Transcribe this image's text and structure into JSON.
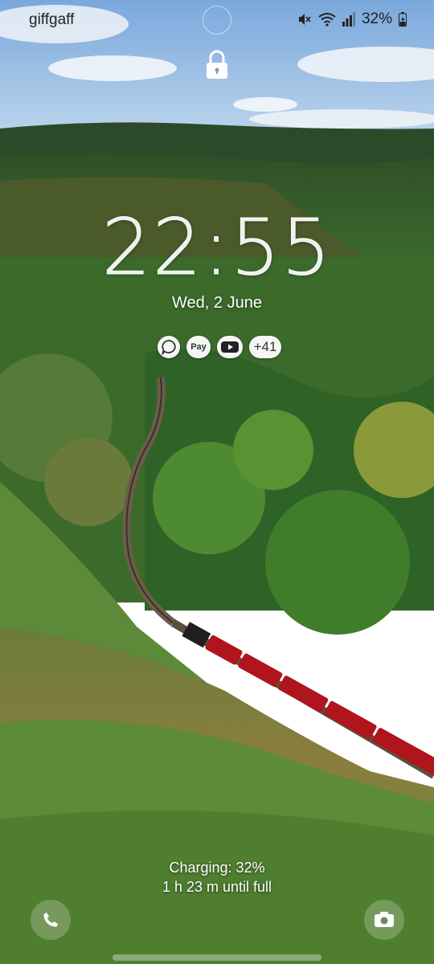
{
  "status_bar": {
    "carrier": "giffgaff",
    "battery_percent_label": "32%",
    "icons": [
      "mute-icon",
      "wifi-icon",
      "signal-icon",
      "battery-charging-icon"
    ]
  },
  "lock_screen": {
    "lock_icon": "padlock-icon",
    "clock": {
      "hours": "22",
      "separator": ":",
      "minutes": "55"
    },
    "date": "Wed, 2 June",
    "notifications": [
      {
        "icon": "messages-icon"
      },
      {
        "label": "Pay",
        "icon": "samsung-pay-icon"
      },
      {
        "icon": "youtube-icon"
      },
      {
        "label": "+41"
      }
    ],
    "charging": {
      "status": "Charging: 32%",
      "time_left": "1 h 23 m until full"
    },
    "shortcuts": {
      "left": "phone-icon",
      "right": "camera-icon"
    }
  },
  "colors": {
    "sky": "#8fb8e0",
    "forest": "#3f6b2a",
    "train": "#b0141c",
    "moor": "#9a8640"
  }
}
